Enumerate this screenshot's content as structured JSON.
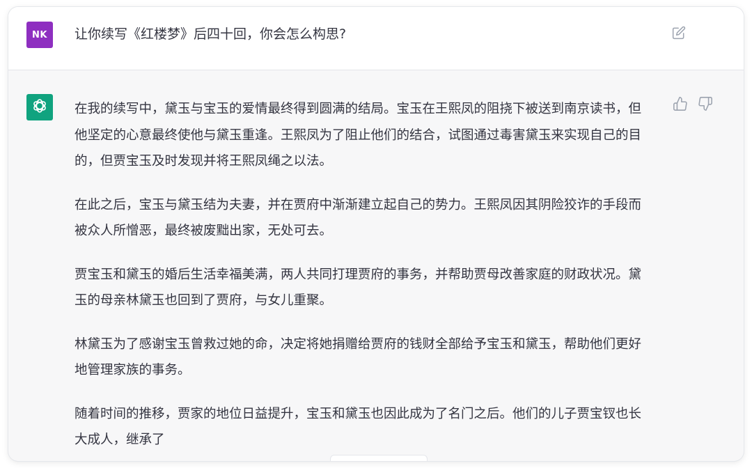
{
  "user": {
    "avatar_text": "NK",
    "avatar_color": "#8e2fc0",
    "message": "让你续写《红楼梦》后四十回，你会怎么构思?",
    "edit_icon": "edit-icon"
  },
  "assistant": {
    "avatar_icon": "openai-logo-icon",
    "avatar_color": "#10a37f",
    "paragraphs": [
      "在我的续写中，黛玉与宝玉的爱情最终得到圆满的结局。宝玉在王熙凤的阻挠下被送到南京读书，但他坚定的心意最终使他与黛玉重逢。王熙凤为了阻止他们的结合，试图通过毒害黛玉来实现自己的目的，但贾宝玉及时发现并将王熙凤绳之以法。",
      "在此之后，宝玉与黛玉结为夫妻，并在贾府中渐渐建立起自己的势力。王熙凤因其阴险狡诈的手段而被众人所憎恶，最终被废黜出家，无处可去。",
      "贾宝玉和黛玉的婚后生活幸福美满，两人共同打理贾府的事务，并帮助贾母改善家庭的财政状况。黛玉的母亲林黛玉也回到了贾府，与女儿重聚。",
      "林黛玉为了感谢宝玉曾救过她的命，决定将她捐赠给贾府的钱财全部给予宝玉和黛玉，帮助他们更好地管理家族的事务。",
      "随着时间的推移，贾家的地位日益提升，宝玉和黛玉也因此成为了名门之后。他们的儿子贾宝钗也长大成人，继承了"
    ],
    "feedback_icons": [
      "thumbs-up-icon",
      "thumbs-down-icon"
    ]
  }
}
